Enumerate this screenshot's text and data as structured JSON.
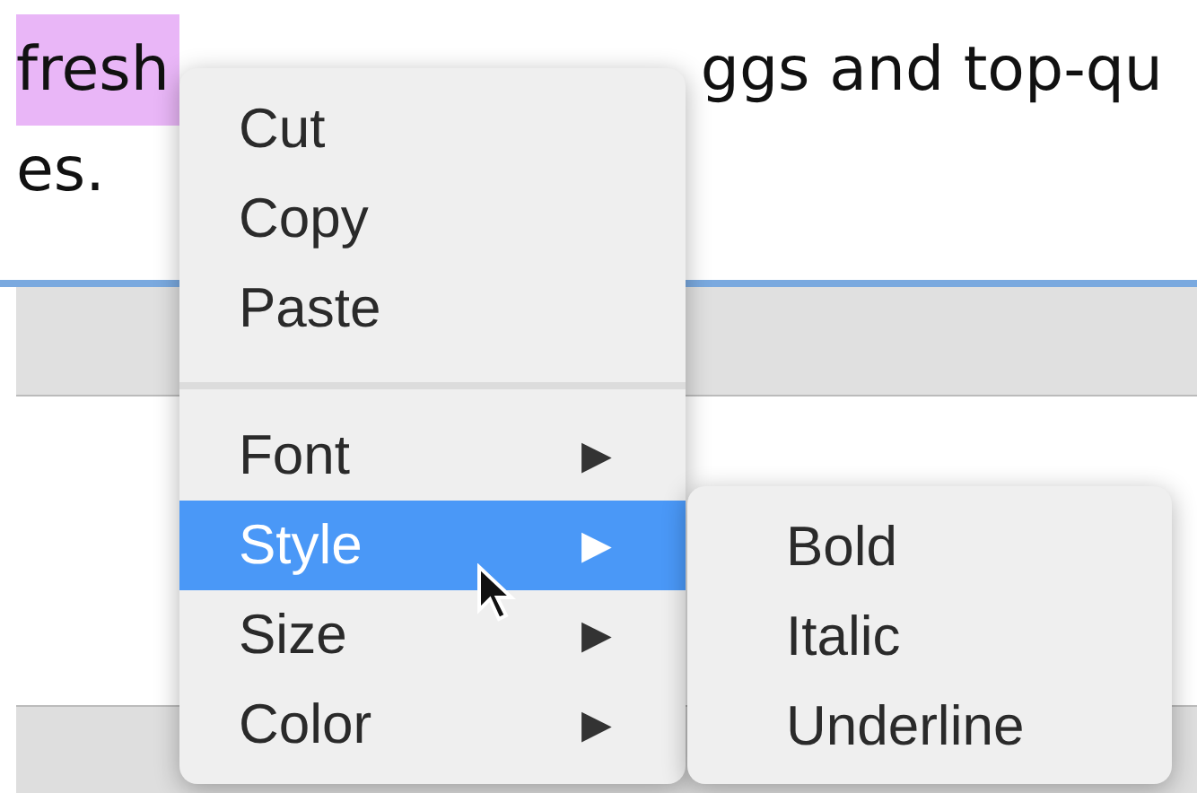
{
  "document": {
    "line_1": [
      {
        "text": "fresh",
        "highlighted": true
      },
      {
        "text": "ggs and top-qu",
        "highlighted": false
      }
    ],
    "line_2": "es."
  },
  "context_menu": {
    "items": [
      {
        "kind": "action",
        "label": "Cut"
      },
      {
        "kind": "action",
        "label": "Copy"
      },
      {
        "kind": "action",
        "label": "Paste"
      },
      {
        "kind": "separator"
      },
      {
        "kind": "submenu",
        "label": "Font",
        "arrow": "▶",
        "selected": false
      },
      {
        "kind": "submenu",
        "label": "Style",
        "arrow": "▶",
        "selected": true
      },
      {
        "kind": "submenu",
        "label": "Size",
        "arrow": "▶",
        "selected": false
      },
      {
        "kind": "submenu",
        "label": "Color",
        "arrow": "▶",
        "selected": false
      }
    ]
  },
  "submenu": {
    "items": [
      {
        "label": "Bold"
      },
      {
        "label": "Italic"
      },
      {
        "label": "Underline"
      }
    ]
  }
}
